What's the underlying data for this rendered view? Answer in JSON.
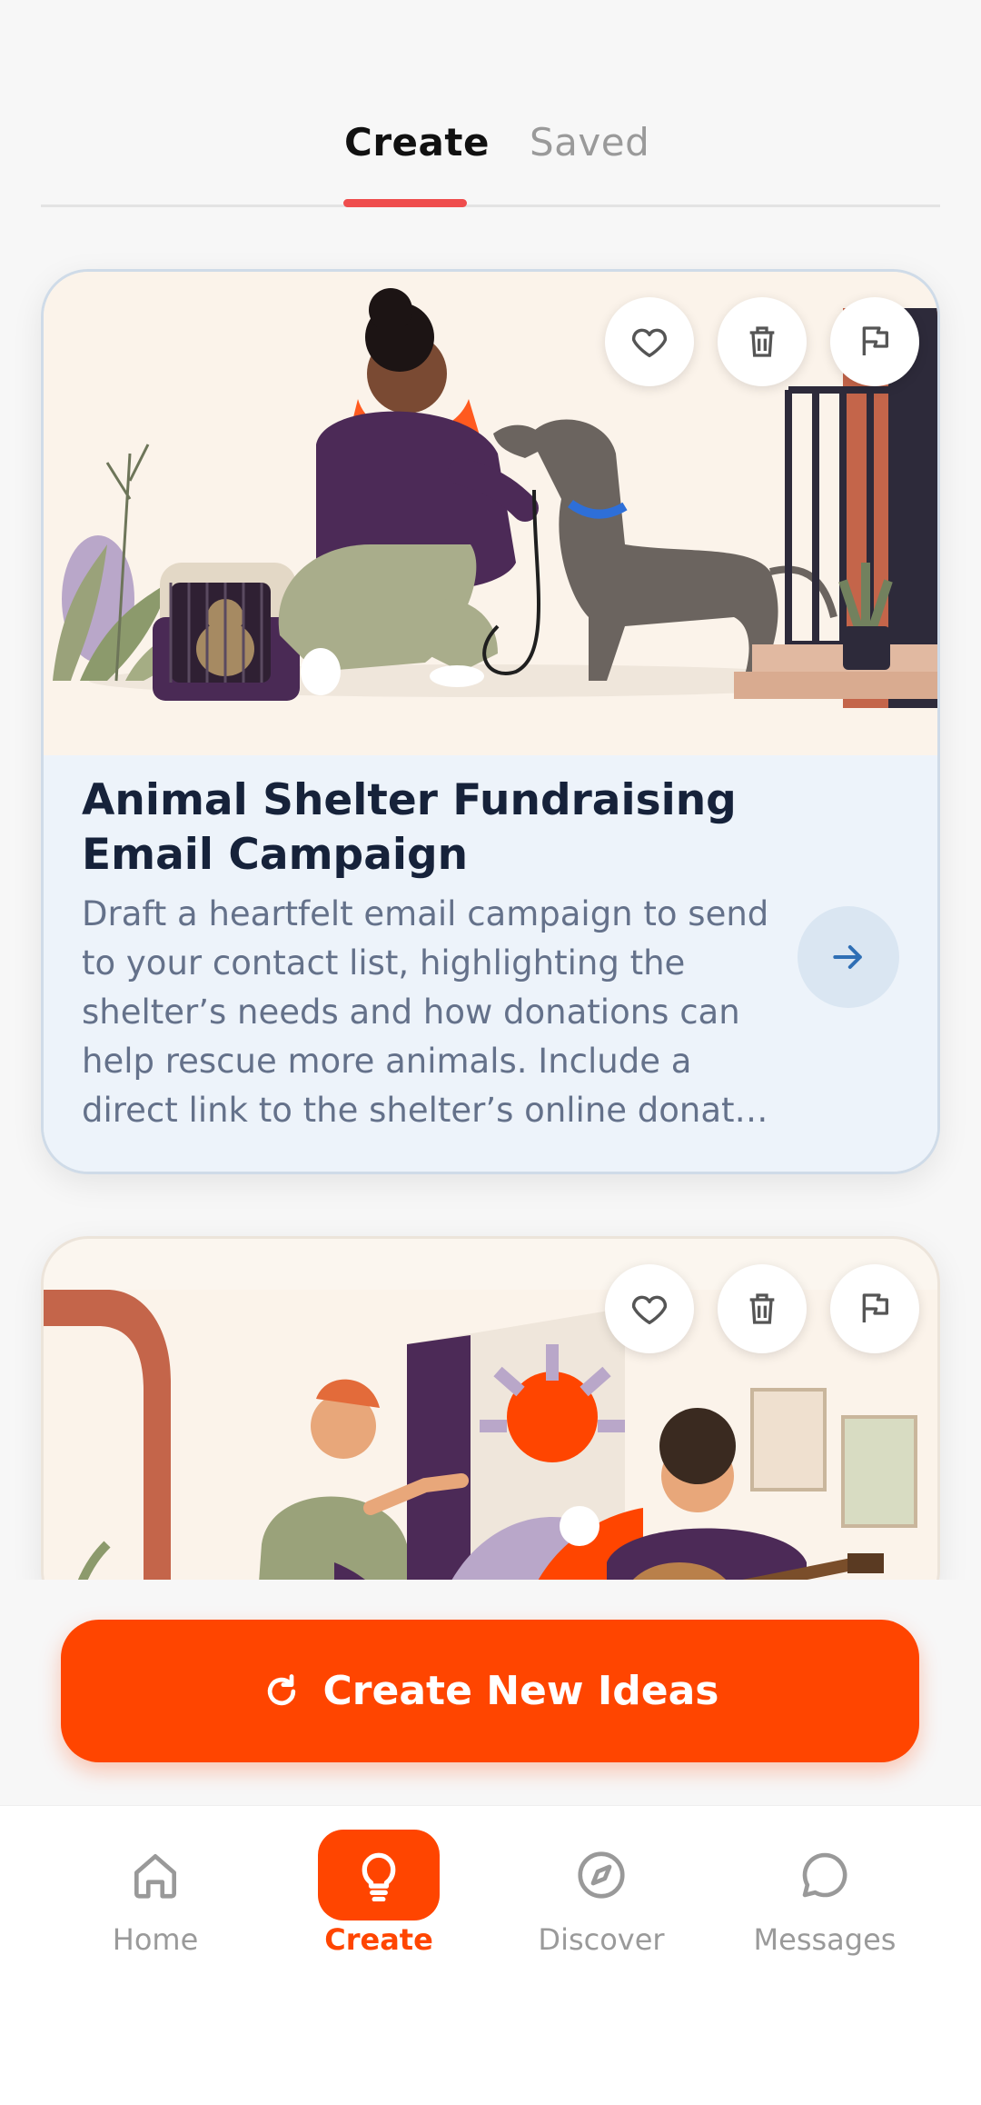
{
  "tabs": {
    "create": "Create",
    "saved": "Saved",
    "active": "Create"
  },
  "cards": [
    {
      "title": "Animal Shelter Fundraising Email Campaign",
      "description": "Draft a heartfelt email campaign to send to your contact list, highlighting the shelter’s needs and how donations can help rescue more animals. Include a direct link to the shelter’s online donat…",
      "image_alt": "Person kneeling to pet a greyhound beside a cat carrier"
    },
    {
      "image_alt": "Two people painting a mural and playing guitar"
    }
  ],
  "card_actions": {
    "like_icon": "heart-icon",
    "delete_icon": "trash-icon",
    "flag_icon": "flag-icon",
    "open_icon": "arrow-right-icon"
  },
  "cta": {
    "label": "Create New Ideas",
    "icon": "refresh-icon"
  },
  "nav": {
    "items": [
      {
        "label": "Home",
        "icon": "home-icon"
      },
      {
        "label": "Create",
        "icon": "lightbulb-icon",
        "active": true
      },
      {
        "label": "Discover",
        "icon": "compass-icon"
      },
      {
        "label": "Messages",
        "icon": "chat-bubble-icon"
      }
    ]
  },
  "colors": {
    "accent": "#ff4500",
    "tab_indicator": "#ef4d4d",
    "title": "#16223a",
    "card_body": "#edf3fa"
  }
}
